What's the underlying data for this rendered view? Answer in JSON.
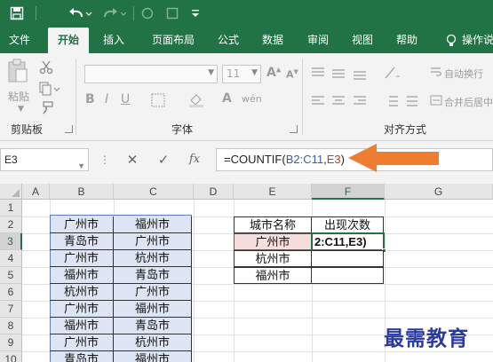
{
  "quick_access": {
    "icons": [
      "save-icon",
      "undo-icon",
      "redo-icon",
      "shape-icon",
      "customize-icon"
    ]
  },
  "ribbon_tabs": [
    "文件",
    "开始",
    "插入",
    "页面布局",
    "公式",
    "数据",
    "审阅",
    "视图",
    "帮助",
    "操作说"
  ],
  "active_tab": "开始",
  "ribbon": {
    "paste_label": "粘贴",
    "clipboard_label": "剪贴板",
    "font_label": "字体",
    "font_size": "11",
    "alignment_label": "对齐方式",
    "wrap_text_label": "自动换行",
    "merge_center_label": "合并后居中"
  },
  "formula_bar": {
    "name_box": "E3",
    "cancel_glyph": "✕",
    "confirm_glyph": "✓",
    "fx_label": "fx",
    "formula_prefix": "=COUNTIF(",
    "formula_range": "B2:C11",
    "formula_sep": ",",
    "formula_criteria": "E3",
    "formula_suffix": ")"
  },
  "grid": {
    "column_headers": [
      "A",
      "B",
      "C",
      "D",
      "E",
      "F",
      "G"
    ],
    "selected_column": "F",
    "row_headers": [
      "1",
      "2",
      "3",
      "4",
      "5",
      "6",
      "7",
      "8",
      "9",
      "10"
    ],
    "selected_row": "3",
    "data_rows": [
      [
        "广州市",
        "福州市"
      ],
      [
        "青岛市",
        "广州市"
      ],
      [
        "广州市",
        "杭州市"
      ],
      [
        "福州市",
        "青岛市"
      ],
      [
        "杭州市",
        "广州市"
      ],
      [
        "广州市",
        "福州市"
      ],
      [
        "福州市",
        "青岛市"
      ],
      [
        "广州市",
        "杭州市"
      ],
      [
        "青岛市",
        "福州市"
      ]
    ],
    "summary_table": {
      "headers": [
        "城市名称",
        "出现次数"
      ],
      "cities": [
        "广州市",
        "杭州市",
        "福州市"
      ],
      "f3_edit_text": "2:C11,E3)"
    }
  },
  "watermark": "最需教育",
  "colors": {
    "excel_green": "#217346",
    "arrow_orange": "#ed7d31",
    "range_blue": "#dde5f4",
    "criteria_red": "#c0392b"
  }
}
